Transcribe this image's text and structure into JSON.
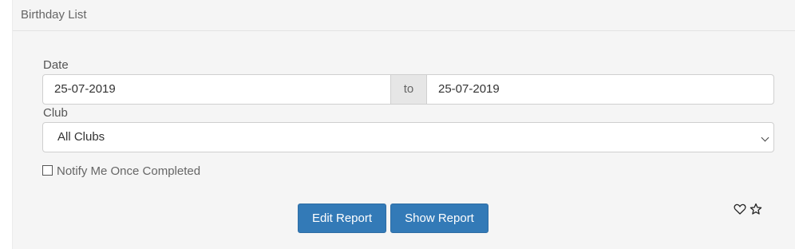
{
  "panel": {
    "title": "Birthday List"
  },
  "form": {
    "date_label": "Date",
    "date_from_value": "25-07-2019",
    "date_separator": "to",
    "date_to_value": "25-07-2019",
    "club_label": "Club",
    "club_selected": "All Clubs",
    "notify_label": "Notify Me Once Completed",
    "notify_checked": false
  },
  "actions": {
    "edit_label": "Edit Report",
    "show_label": "Show Report"
  },
  "icons": {
    "favorite": "heart-icon",
    "bookmark": "star-icon"
  },
  "colors": {
    "primary_button": "#337ab7",
    "panel_background": "#f5f5f5"
  }
}
